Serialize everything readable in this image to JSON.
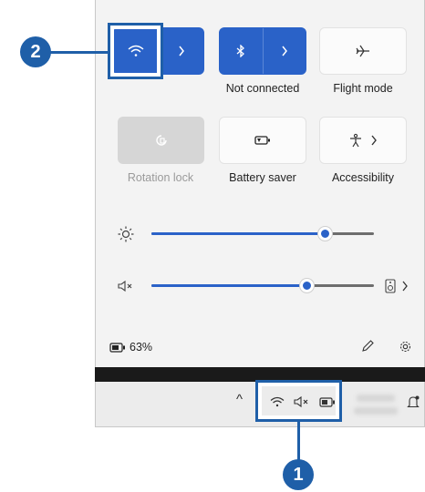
{
  "tiles": {
    "wifi": {
      "label": "",
      "icon": "wifi-icon"
    },
    "bluetooth": {
      "label": "Not connected",
      "icon": "bluetooth-icon"
    },
    "flight": {
      "label": "Flight mode",
      "icon": "airplane-icon"
    },
    "rotation": {
      "label": "Rotation lock",
      "icon": "rotation-lock-icon"
    },
    "battery_saver": {
      "label": "Battery saver",
      "icon": "battery-saver-icon"
    },
    "accessibility": {
      "label": "Accessibility",
      "icon": "accessibility-icon"
    }
  },
  "sliders": {
    "brightness": {
      "value": 0.78,
      "icon": "brightness-icon"
    },
    "volume": {
      "value": 0.7,
      "icon": "volume-muted-icon",
      "output_icon": "speaker-icon"
    }
  },
  "footer": {
    "battery_percent": "63%",
    "edit_icon": "pencil-icon",
    "settings_icon": "gear-icon"
  },
  "taskbar": {
    "chevron": "^",
    "tray_icons": [
      "wifi-icon",
      "volume-muted-icon",
      "battery-icon"
    ]
  },
  "callouts": {
    "one": "1",
    "two": "2"
  },
  "colors": {
    "accent": "#2a62c8",
    "callout": "#1f5fa8"
  }
}
